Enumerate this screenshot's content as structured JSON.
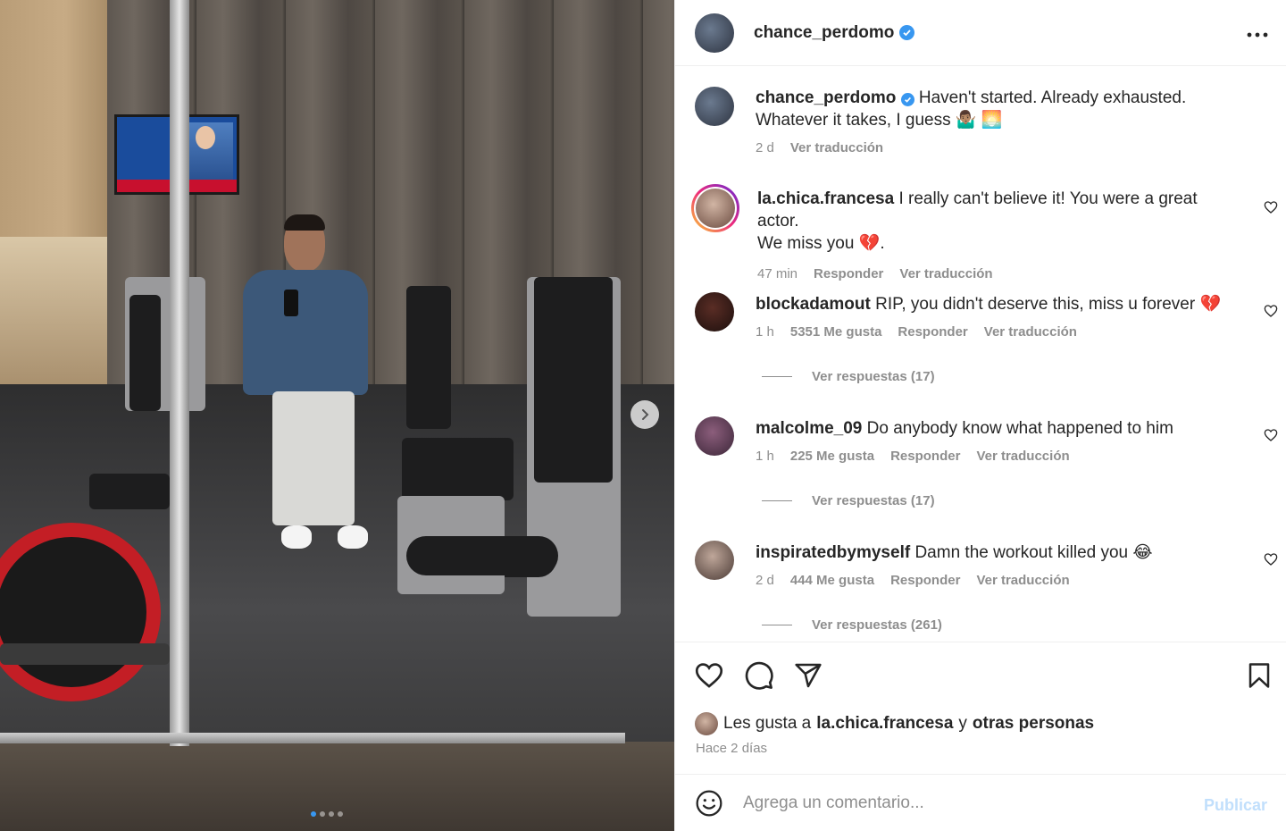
{
  "post": {
    "username": "chance_perdomo",
    "verified": true,
    "caption_line1": "Haven't started. Already exhausted.",
    "caption_line2": "Whatever it takes, I guess",
    "caption_emojis": "🤷🏽‍♂️ 🌅",
    "caption_age": "2 d",
    "see_translation": "Ver traducción",
    "carousel": {
      "total": 4,
      "current": 1
    }
  },
  "comments": [
    {
      "username": "la.chica.francesa",
      "text": "I really can't believe it! You were a great actor.",
      "text2": "We miss you",
      "emoji": "💔",
      "suffix": ".",
      "age": "47 min",
      "likes": "",
      "reply": "Responder",
      "translate": "Ver traducción",
      "replies": ""
    },
    {
      "username": "blockadamout",
      "text": "RIP, you didn't deserve this, miss u forever",
      "emoji": "💔",
      "age": "1 h",
      "likes": "5351 Me gusta",
      "reply": "Responder",
      "translate": "Ver traducción",
      "replies": "Ver respuestas (17)"
    },
    {
      "username": "malcolme_09",
      "text": "Do anybody know what happened to him",
      "emoji": "",
      "age": "1 h",
      "likes": "225 Me gusta",
      "reply": "Responder",
      "translate": "Ver traducción",
      "replies": "Ver respuestas (17)"
    },
    {
      "username": "inspiratedbymyself",
      "text": "Damn the workout killed you",
      "emoji": "😂",
      "age": "2 d",
      "likes": "444 Me gusta",
      "reply": "Responder",
      "translate": "Ver traducción",
      "replies": "Ver respuestas (261)"
    }
  ],
  "likes_bar": {
    "prefix": "Les gusta a",
    "user": "la.chica.francesa",
    "joiner": "y",
    "others": "otras personas",
    "date": "Hace 2 días"
  },
  "composer": {
    "placeholder": "Agrega un comentario...",
    "publish": "Publicar"
  },
  "colors": {
    "verified": "#3897f0",
    "secondary_text": "#8e8e8e",
    "publish_disabled": "#c1dffc"
  },
  "icons": [
    "more-icon",
    "heart-icon",
    "comment-icon",
    "share-icon",
    "bookmark-icon",
    "emoji-icon",
    "chevron-right-icon",
    "verified-icon"
  ]
}
